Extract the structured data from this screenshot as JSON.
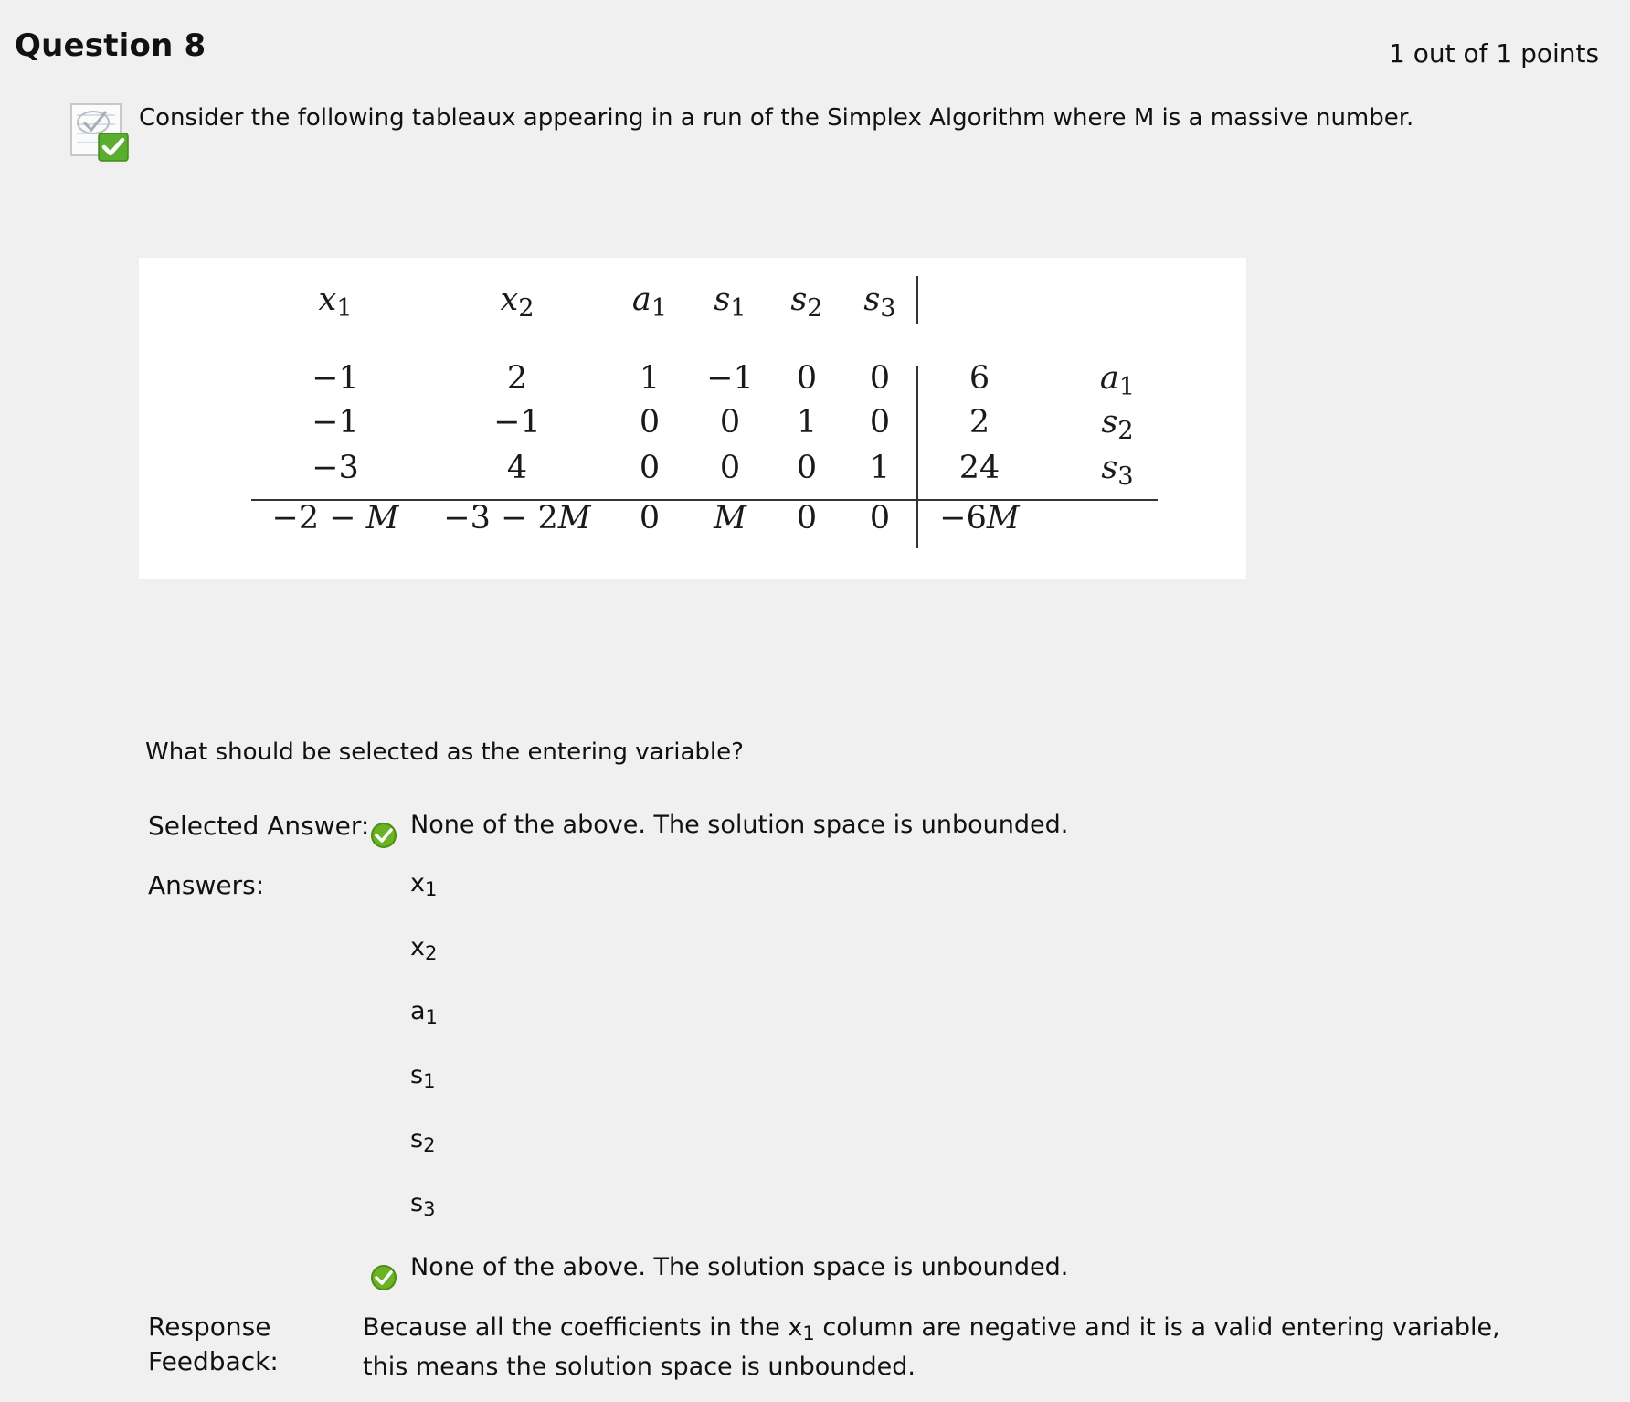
{
  "question": {
    "title": "Question 8",
    "points": "1 out of 1 points",
    "status_icon": "graded-correct-icon",
    "prompt": "Consider the following tableaux appearing in a run of the Simplex Algorithm where M is a massive number."
  },
  "tableau": {
    "headers": [
      "x1",
      "x2",
      "a1",
      "s1",
      "s2",
      "s3"
    ],
    "rows": [
      {
        "cells": [
          "−1",
          "2",
          "1",
          "−1",
          "0",
          "0"
        ],
        "rhs": "6",
        "basis": "a1"
      },
      {
        "cells": [
          "−1",
          "−1",
          "0",
          "0",
          "1",
          "0"
        ],
        "rhs": "2",
        "basis": "s2"
      },
      {
        "cells": [
          "−3",
          "4",
          "0",
          "0",
          "0",
          "1"
        ],
        "rhs": "24",
        "basis": "s3"
      }
    ],
    "objective": {
      "cells": [
        "−2 − M",
        "−3 − 2M",
        "0",
        "M",
        "0",
        "0"
      ],
      "rhs": "−6M"
    }
  },
  "entering_question": "What should be selected as the entering variable?",
  "selected_answer": {
    "label": "Selected Answer:",
    "value": "None of the above.  The solution space is unbounded.",
    "icon": "correct-check-icon"
  },
  "answers": {
    "label": "Answers:",
    "options": [
      {
        "var": "x",
        "sub": "1"
      },
      {
        "var": "x",
        "sub": "2"
      },
      {
        "var": "a",
        "sub": "1"
      },
      {
        "var": "s",
        "sub": "1"
      },
      {
        "var": "s",
        "sub": "2"
      },
      {
        "var": "s",
        "sub": "3"
      }
    ],
    "correct_option": "None of the above.  The solution space is unbounded.",
    "correct_icon": "correct-check-icon"
  },
  "response_feedback": {
    "label_line1": "Response",
    "label_line2": "Feedback:",
    "text_before": "Because all the coefficients in the x",
    "text_sub": "1",
    "text_after": " column are negative and it is a valid entering variable, this means the solution space is unbounded."
  },
  "colors": {
    "background": "#f0f0f0",
    "check_green": "#6bb324",
    "tableau_bg": "#ffffff"
  }
}
